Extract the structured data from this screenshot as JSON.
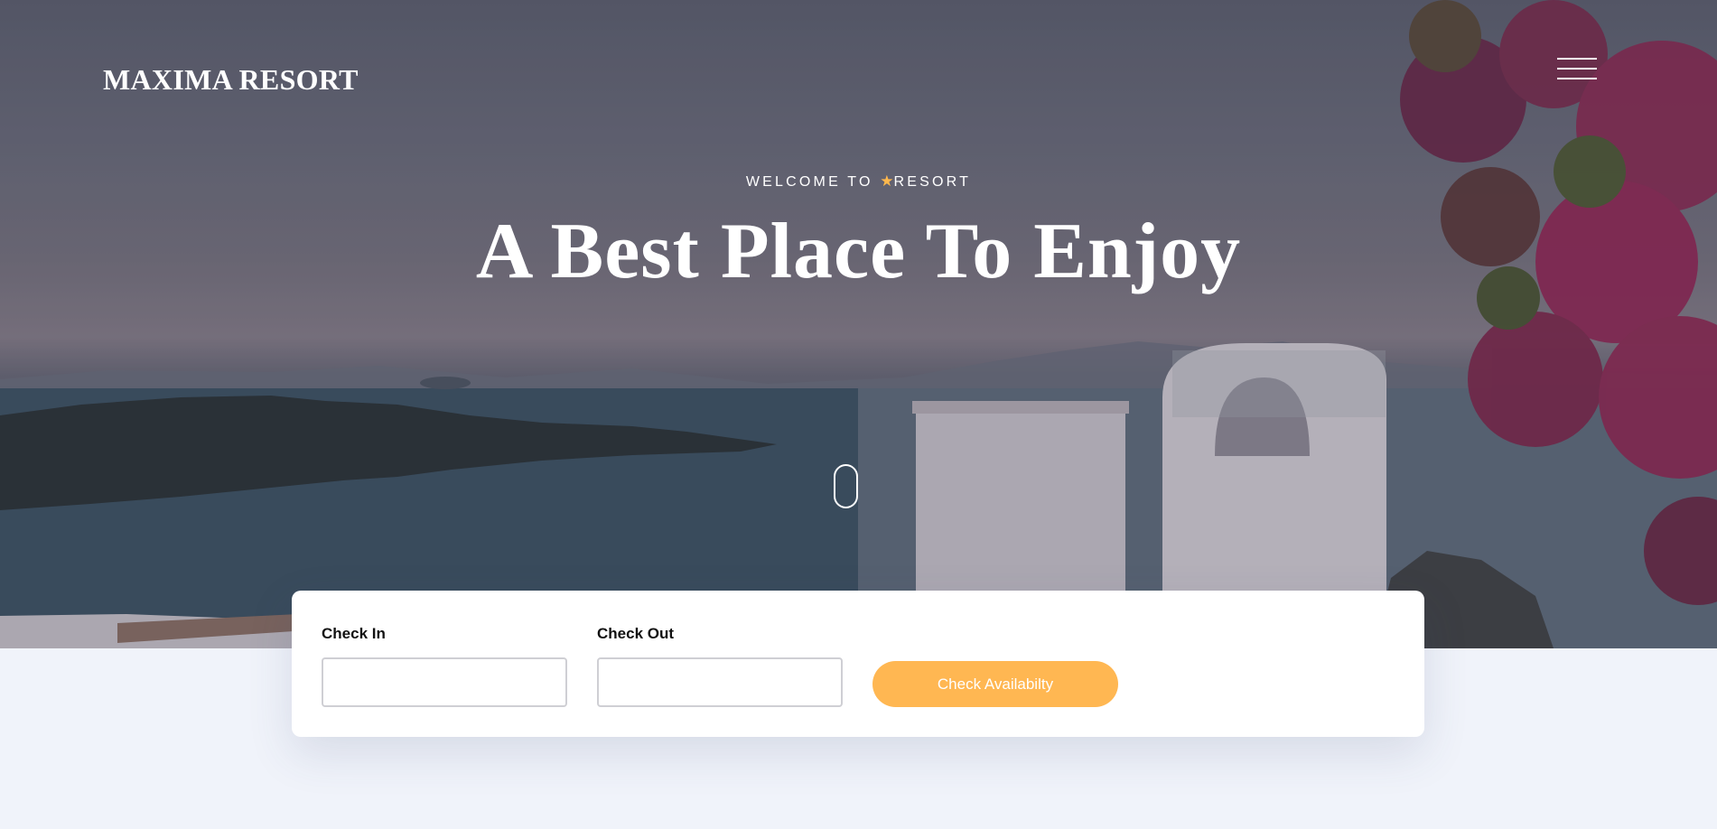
{
  "header": {
    "logo_text": "MAXIMA RESORT",
    "menu_icon": "hamburger-icon"
  },
  "hero": {
    "welcome_prefix": "WELCOME TO ",
    "welcome_icon": "star-icon",
    "welcome_suffix": "RESORT",
    "headline": "A Best Place To Enjoy",
    "scroll_icon": "scroll-mouse-icon"
  },
  "booking": {
    "check_in_label": "Check In",
    "check_in_value": "",
    "check_out_label": "Check Out",
    "check_out_value": "",
    "submit_label": "Check Availabilty"
  },
  "colors": {
    "accent": "#ffb752",
    "page_background": "#f0f3fa",
    "text_light": "#ffffff"
  }
}
